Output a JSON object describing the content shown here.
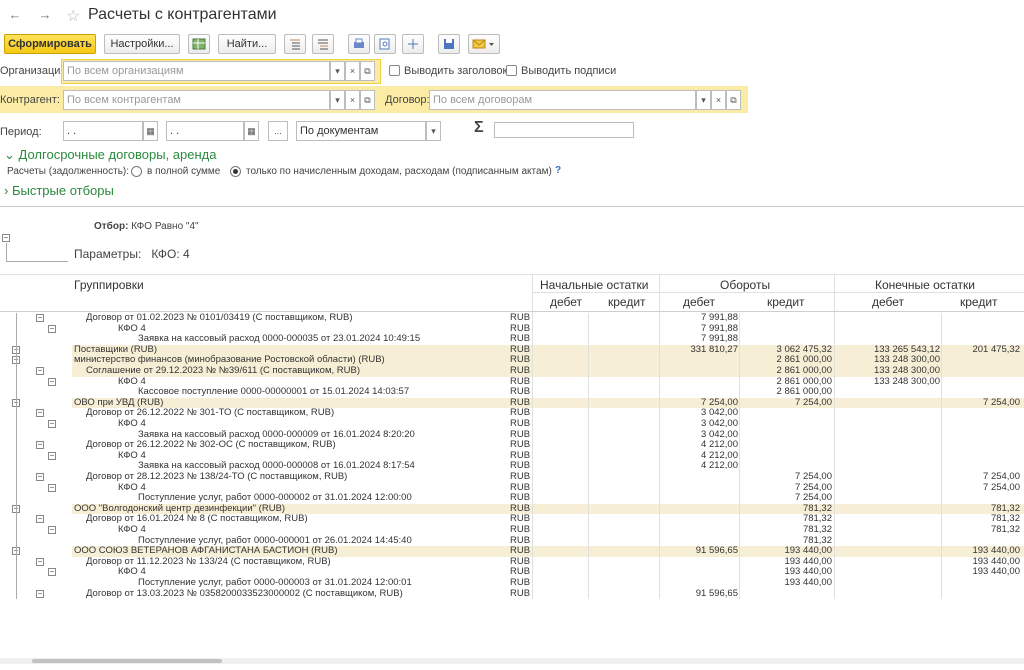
{
  "window": {
    "title": "Расчеты с контрагентами"
  },
  "toolbar": {
    "generate_label": "Сформировать",
    "settings_label": "Настройки...",
    "find_label": "Найти..."
  },
  "form": {
    "org_label": "Организация:",
    "org_placeholder": "По всем организациям",
    "show_header_label": "Выводить заголовок",
    "show_signatures_label": "Выводить подписи",
    "counterparty_label": "Контрагент:",
    "counterparty_placeholder": "По всем контрагентам",
    "contract_label": "Договор:",
    "contract_placeholder": "По всем договорам",
    "period_label": "Период:",
    "date_from": ". .",
    "date_to": ". .",
    "period_ellipsis": "...",
    "by_documents": "По документам",
    "sigma": "Σ",
    "longterm_group": "Долгосрочные договоры, аренда",
    "settlements_label": "Расчеты (задолженность):",
    "option_full": "в полной сумме",
    "option_accrued": "только по начисленным доходам, расходам (подписанным актам)",
    "help": "?",
    "quick_filters": "Быстрые отборы"
  },
  "report": {
    "filter_label": "Отбор:",
    "filter_value": "КФО Равно \"4\"",
    "params_label": "Параметры:",
    "params_value": "КФО: 4",
    "headers": {
      "groupings": "Группировки",
      "opening": "Начальные остатки",
      "turnover": "Обороты",
      "closing": "Конечные остатки",
      "debit": "дебет",
      "credit": "кредит"
    },
    "rows": [
      {
        "level": 1,
        "hl": false,
        "name": "Договор от 01.02.2023 № 0101/03419 (С поставщиком, RUB)",
        "cur": "RUB",
        "od": "",
        "oc": "",
        "td": "7 991,88",
        "tc": "",
        "cd": "",
        "cc": ""
      },
      {
        "level": 2,
        "hl": false,
        "name": "КФО 4",
        "cur": "RUB",
        "od": "",
        "oc": "",
        "td": "7 991,88",
        "tc": "",
        "cd": "",
        "cc": ""
      },
      {
        "level": 3,
        "hl": false,
        "name": "Заявка на кассовый расход 0000-000035 от 23.01.2024 10:49:15",
        "cur": "RUB",
        "od": "",
        "oc": "",
        "td": "7 991,88",
        "tc": "",
        "cd": "",
        "cc": ""
      },
      {
        "level": 0,
        "hl": true,
        "name": "Поставщики (RUB)",
        "cur": "RUB",
        "od": "",
        "oc": "",
        "td": "331 810,27",
        "tc": "3 062 475,32",
        "cd": "133 265 543,12",
        "cc": "201 475,32"
      },
      {
        "level": 0,
        "hl": true,
        "name": "министерство финансов (минобразование Ростовской области) (RUB)",
        "cur": "RUB",
        "od": "",
        "oc": "",
        "td": "",
        "tc": "2 861 000,00",
        "cd": "133 248 300,00",
        "cc": ""
      },
      {
        "level": 1,
        "hl": true,
        "name": "Соглашение от 29.12.2023 № №39/611 (С поставщиком, RUB)",
        "cur": "RUB",
        "od": "",
        "oc": "",
        "td": "",
        "tc": "2 861 000,00",
        "cd": "133 248 300,00",
        "cc": ""
      },
      {
        "level": 2,
        "hl": false,
        "name": "КФО 4",
        "cur": "RUB",
        "od": "",
        "oc": "",
        "td": "",
        "tc": "2 861 000,00",
        "cd": "133 248 300,00",
        "cc": ""
      },
      {
        "level": 3,
        "hl": false,
        "name": "Кассовое поступление 0000-00000001 от 15.01.2024 14:03:57",
        "cur": "RUB",
        "od": "",
        "oc": "",
        "td": "",
        "tc": "2 861 000,00",
        "cd": "",
        "cc": ""
      },
      {
        "level": 0,
        "hl": true,
        "name": "ОВО при УВД (RUB)",
        "cur": "RUB",
        "od": "",
        "oc": "",
        "td": "7 254,00",
        "tc": "7 254,00",
        "cd": "",
        "cc": "7 254,00"
      },
      {
        "level": 1,
        "hl": false,
        "name": "Договор от 26.12.2022 № 301-ТО (С поставщиком, RUB)",
        "cur": "RUB",
        "od": "",
        "oc": "",
        "td": "3 042,00",
        "tc": "",
        "cd": "",
        "cc": ""
      },
      {
        "level": 2,
        "hl": false,
        "name": "КФО 4",
        "cur": "RUB",
        "od": "",
        "oc": "",
        "td": "3 042,00",
        "tc": "",
        "cd": "",
        "cc": ""
      },
      {
        "level": 3,
        "hl": false,
        "name": "Заявка на кассовый расход 0000-000009 от 16.01.2024 8:20:20",
        "cur": "RUB",
        "od": "",
        "oc": "",
        "td": "3 042,00",
        "tc": "",
        "cd": "",
        "cc": ""
      },
      {
        "level": 1,
        "hl": false,
        "name": "Договор от 26.12.2022 № 302-ОС (С поставщиком, RUB)",
        "cur": "RUB",
        "od": "",
        "oc": "",
        "td": "4 212,00",
        "tc": "",
        "cd": "",
        "cc": ""
      },
      {
        "level": 2,
        "hl": false,
        "name": "КФО 4",
        "cur": "RUB",
        "od": "",
        "oc": "",
        "td": "4 212,00",
        "tc": "",
        "cd": "",
        "cc": ""
      },
      {
        "level": 3,
        "hl": false,
        "name": "Заявка на кассовый расход 0000-000008 от 16.01.2024 8:17:54",
        "cur": "RUB",
        "od": "",
        "oc": "",
        "td": "4 212,00",
        "tc": "",
        "cd": "",
        "cc": ""
      },
      {
        "level": 1,
        "hl": false,
        "name": "Договор от 28.12.2023 № 138/24-ТО (С поставщиком, RUB)",
        "cur": "RUB",
        "od": "",
        "oc": "",
        "td": "",
        "tc": "7 254,00",
        "cd": "",
        "cc": "7 254,00"
      },
      {
        "level": 2,
        "hl": false,
        "name": "КФО 4",
        "cur": "RUB",
        "od": "",
        "oc": "",
        "td": "",
        "tc": "7 254,00",
        "cd": "",
        "cc": "7 254,00"
      },
      {
        "level": 3,
        "hl": false,
        "name": "Поступление услуг, работ 0000-000002 от 31.01.2024 12:00:00",
        "cur": "RUB",
        "od": "",
        "oc": "",
        "td": "",
        "tc": "7 254,00",
        "cd": "",
        "cc": ""
      },
      {
        "level": 0,
        "hl": true,
        "name": "ООО \"Волгодонский центр дезинфекции\" (RUB)",
        "cur": "RUB",
        "od": "",
        "oc": "",
        "td": "",
        "tc": "781,32",
        "cd": "",
        "cc": "781,32"
      },
      {
        "level": 1,
        "hl": false,
        "name": "Договор от 16.01.2024 № 8 (С поставщиком, RUB)",
        "cur": "RUB",
        "od": "",
        "oc": "",
        "td": "",
        "tc": "781,32",
        "cd": "",
        "cc": "781,32"
      },
      {
        "level": 2,
        "hl": false,
        "name": "КФО 4",
        "cur": "RUB",
        "od": "",
        "oc": "",
        "td": "",
        "tc": "781,32",
        "cd": "",
        "cc": "781,32"
      },
      {
        "level": 3,
        "hl": false,
        "name": "Поступление услуг, работ 0000-000001 от 26.01.2024 14:45:40",
        "cur": "RUB",
        "od": "",
        "oc": "",
        "td": "",
        "tc": "781,32",
        "cd": "",
        "cc": ""
      },
      {
        "level": 0,
        "hl": true,
        "name": "ООО СОЮЗ ВЕТЕРАНОВ АФГАНИСТАНА БАСТИОН (RUB)",
        "cur": "RUB",
        "od": "",
        "oc": "",
        "td": "91 596,65",
        "tc": "193 440,00",
        "cd": "",
        "cc": "193 440,00"
      },
      {
        "level": 1,
        "hl": false,
        "name": "Договор от 11.12.2023 № 133/24 (С поставщиком, RUB)",
        "cur": "RUB",
        "od": "",
        "oc": "",
        "td": "",
        "tc": "193 440,00",
        "cd": "",
        "cc": "193 440,00"
      },
      {
        "level": 2,
        "hl": false,
        "name": "КФО 4",
        "cur": "RUB",
        "od": "",
        "oc": "",
        "td": "",
        "tc": "193 440,00",
        "cd": "",
        "cc": "193 440,00"
      },
      {
        "level": 3,
        "hl": false,
        "name": "Поступление услуг, работ 0000-000003 от 31.01.2024 12:00:01",
        "cur": "RUB",
        "od": "",
        "oc": "",
        "td": "",
        "tc": "193 440,00",
        "cd": "",
        "cc": ""
      },
      {
        "level": 1,
        "hl": false,
        "name": "Договор от 13.03.2023 № 0358200033523000002 (С поставщиком, RUB)",
        "cur": "RUB",
        "od": "",
        "oc": "",
        "td": "91 596,65",
        "tc": "",
        "cd": "",
        "cc": ""
      }
    ]
  }
}
